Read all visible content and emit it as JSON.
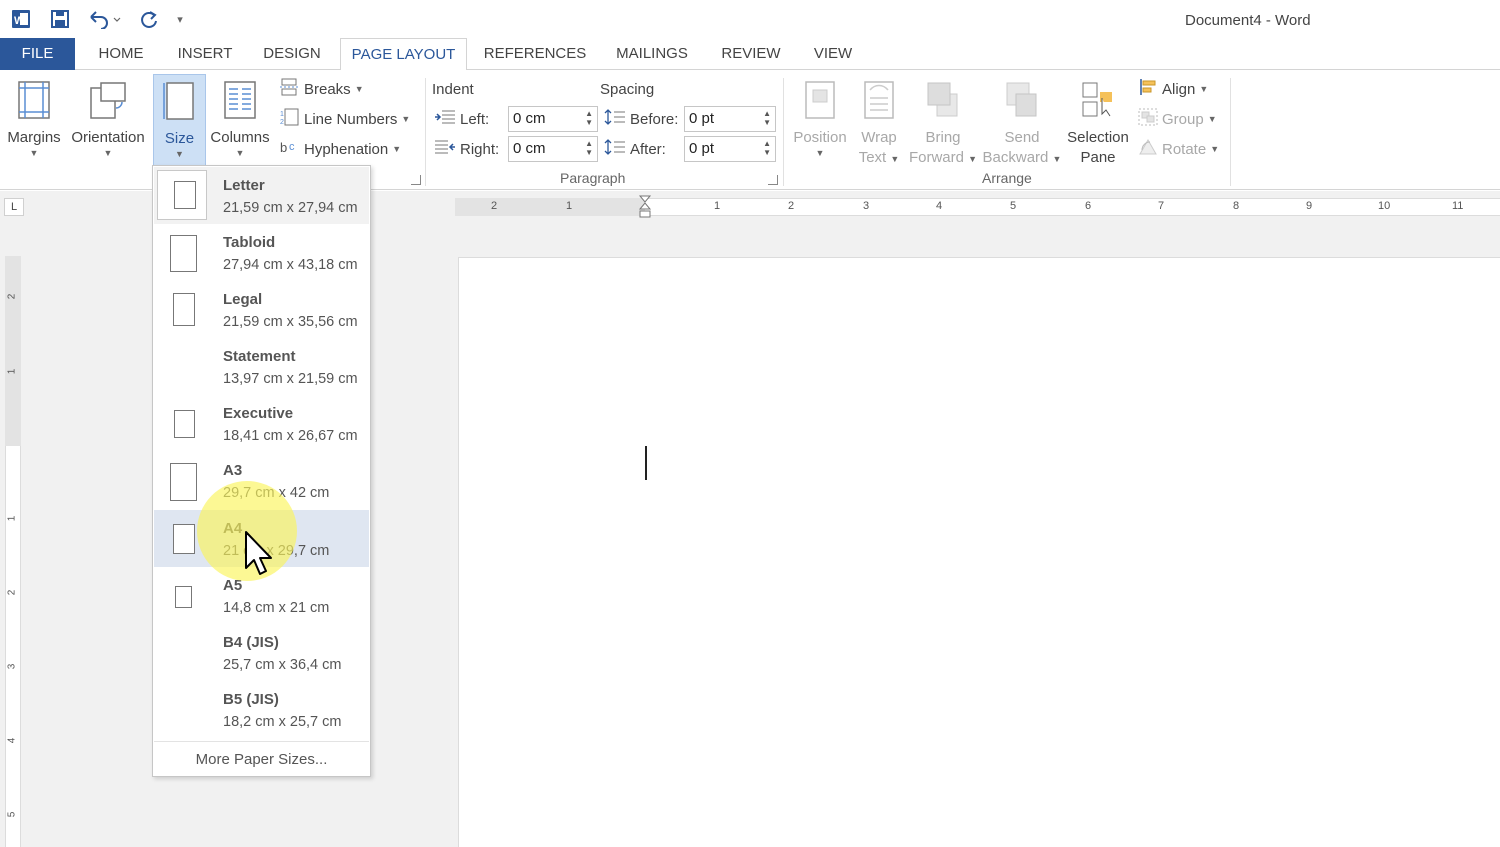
{
  "window": {
    "title": "Document4 - Word"
  },
  "quick_access": {
    "word_icon": "word-icon",
    "save_icon": "save-icon",
    "undo_icon": "undo-icon",
    "redo_icon": "redo-icon",
    "customize_icon": "customize-qat-icon"
  },
  "tabs": [
    {
      "label": "FILE"
    },
    {
      "label": "HOME"
    },
    {
      "label": "INSERT"
    },
    {
      "label": "DESIGN"
    },
    {
      "label": "PAGE LAYOUT",
      "active": true
    },
    {
      "label": "REFERENCES"
    },
    {
      "label": "MAILINGS"
    },
    {
      "label": "REVIEW"
    },
    {
      "label": "VIEW"
    }
  ],
  "ribbon": {
    "page_setup": {
      "margins": "Margins",
      "orientation": "Orientation",
      "size": "Size",
      "columns": "Columns",
      "breaks": "Breaks",
      "line_numbers": "Line Numbers",
      "hyphenation": "Hyphenation"
    },
    "paragraph": {
      "indent_label": "Indent",
      "spacing_label": "Spacing",
      "left_label": "Left:",
      "left_value": "0 cm",
      "right_label": "Right:",
      "right_value": "0 cm",
      "before_label": "Before:",
      "before_value": "0 pt",
      "after_label": "After:",
      "after_value": "0 pt",
      "group_label": "Paragraph"
    },
    "arrange": {
      "position": "Position",
      "wrap_text_1": "Wrap",
      "wrap_text_2": "Text",
      "bring_forward_1": "Bring",
      "bring_forward_2": "Forward",
      "send_backward_1": "Send",
      "send_backward_2": "Backward",
      "selection_pane_1": "Selection",
      "selection_pane_2": "Pane",
      "align": "Align",
      "group": "Group",
      "rotate": "Rotate",
      "group_label": "Arrange"
    }
  },
  "size_menu": {
    "items": [
      {
        "name": "Letter",
        "dims": "21,59 cm x 27,94 cm"
      },
      {
        "name": "Tabloid",
        "dims": "27,94 cm x 43,18 cm"
      },
      {
        "name": "Legal",
        "dims": "21,59 cm x 35,56 cm"
      },
      {
        "name": "Statement",
        "dims": "13,97 cm x 21,59 cm"
      },
      {
        "name": "Executive",
        "dims": "18,41 cm x 26,67 cm"
      },
      {
        "name": "A3",
        "dims": "29,7 cm x 42 cm"
      },
      {
        "name": "A4",
        "dims": "21 cm x 29,7 cm"
      },
      {
        "name": "A5",
        "dims": "14,8 cm x 21 cm"
      },
      {
        "name": "B4 (JIS)",
        "dims": "25,7 cm x 36,4 cm"
      },
      {
        "name": "B5 (JIS)",
        "dims": "18,2 cm x 25,7 cm"
      }
    ],
    "more": "More Paper Sizes..."
  },
  "ruler": {
    "h_numbers": [
      "2",
      "1",
      "1",
      "2",
      "3",
      "4",
      "5",
      "6",
      "7",
      "8",
      "9",
      "10",
      "11"
    ],
    "v_numbers": [
      "2",
      "1",
      "1",
      "2",
      "3",
      "4",
      "5"
    ],
    "tab_selector": "L"
  },
  "colors": {
    "accent": "#2b579a",
    "hover": "#dfe6f1",
    "highlight": "#f7f25a"
  }
}
